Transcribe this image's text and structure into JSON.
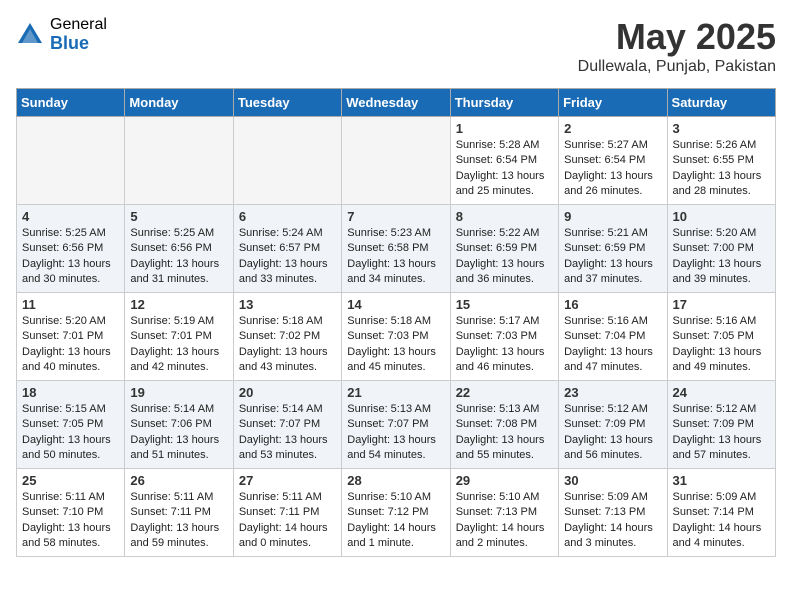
{
  "logo": {
    "general": "General",
    "blue": "Blue"
  },
  "title": {
    "month": "May 2025",
    "location": "Dullewala, Punjab, Pakistan"
  },
  "weekdays": [
    "Sunday",
    "Monday",
    "Tuesday",
    "Wednesday",
    "Thursday",
    "Friday",
    "Saturday"
  ],
  "weeks": [
    {
      "alt": false,
      "days": [
        {
          "num": "",
          "info": ""
        },
        {
          "num": "",
          "info": ""
        },
        {
          "num": "",
          "info": ""
        },
        {
          "num": "",
          "info": ""
        },
        {
          "num": "1",
          "info": "Sunrise: 5:28 AM\nSunset: 6:54 PM\nDaylight: 13 hours\nand 25 minutes."
        },
        {
          "num": "2",
          "info": "Sunrise: 5:27 AM\nSunset: 6:54 PM\nDaylight: 13 hours\nand 26 minutes."
        },
        {
          "num": "3",
          "info": "Sunrise: 5:26 AM\nSunset: 6:55 PM\nDaylight: 13 hours\nand 28 minutes."
        }
      ]
    },
    {
      "alt": true,
      "days": [
        {
          "num": "4",
          "info": "Sunrise: 5:25 AM\nSunset: 6:56 PM\nDaylight: 13 hours\nand 30 minutes."
        },
        {
          "num": "5",
          "info": "Sunrise: 5:25 AM\nSunset: 6:56 PM\nDaylight: 13 hours\nand 31 minutes."
        },
        {
          "num": "6",
          "info": "Sunrise: 5:24 AM\nSunset: 6:57 PM\nDaylight: 13 hours\nand 33 minutes."
        },
        {
          "num": "7",
          "info": "Sunrise: 5:23 AM\nSunset: 6:58 PM\nDaylight: 13 hours\nand 34 minutes."
        },
        {
          "num": "8",
          "info": "Sunrise: 5:22 AM\nSunset: 6:59 PM\nDaylight: 13 hours\nand 36 minutes."
        },
        {
          "num": "9",
          "info": "Sunrise: 5:21 AM\nSunset: 6:59 PM\nDaylight: 13 hours\nand 37 minutes."
        },
        {
          "num": "10",
          "info": "Sunrise: 5:20 AM\nSunset: 7:00 PM\nDaylight: 13 hours\nand 39 minutes."
        }
      ]
    },
    {
      "alt": false,
      "days": [
        {
          "num": "11",
          "info": "Sunrise: 5:20 AM\nSunset: 7:01 PM\nDaylight: 13 hours\nand 40 minutes."
        },
        {
          "num": "12",
          "info": "Sunrise: 5:19 AM\nSunset: 7:01 PM\nDaylight: 13 hours\nand 42 minutes."
        },
        {
          "num": "13",
          "info": "Sunrise: 5:18 AM\nSunset: 7:02 PM\nDaylight: 13 hours\nand 43 minutes."
        },
        {
          "num": "14",
          "info": "Sunrise: 5:18 AM\nSunset: 7:03 PM\nDaylight: 13 hours\nand 45 minutes."
        },
        {
          "num": "15",
          "info": "Sunrise: 5:17 AM\nSunset: 7:03 PM\nDaylight: 13 hours\nand 46 minutes."
        },
        {
          "num": "16",
          "info": "Sunrise: 5:16 AM\nSunset: 7:04 PM\nDaylight: 13 hours\nand 47 minutes."
        },
        {
          "num": "17",
          "info": "Sunrise: 5:16 AM\nSunset: 7:05 PM\nDaylight: 13 hours\nand 49 minutes."
        }
      ]
    },
    {
      "alt": true,
      "days": [
        {
          "num": "18",
          "info": "Sunrise: 5:15 AM\nSunset: 7:05 PM\nDaylight: 13 hours\nand 50 minutes."
        },
        {
          "num": "19",
          "info": "Sunrise: 5:14 AM\nSunset: 7:06 PM\nDaylight: 13 hours\nand 51 minutes."
        },
        {
          "num": "20",
          "info": "Sunrise: 5:14 AM\nSunset: 7:07 PM\nDaylight: 13 hours\nand 53 minutes."
        },
        {
          "num": "21",
          "info": "Sunrise: 5:13 AM\nSunset: 7:07 PM\nDaylight: 13 hours\nand 54 minutes."
        },
        {
          "num": "22",
          "info": "Sunrise: 5:13 AM\nSunset: 7:08 PM\nDaylight: 13 hours\nand 55 minutes."
        },
        {
          "num": "23",
          "info": "Sunrise: 5:12 AM\nSunset: 7:09 PM\nDaylight: 13 hours\nand 56 minutes."
        },
        {
          "num": "24",
          "info": "Sunrise: 5:12 AM\nSunset: 7:09 PM\nDaylight: 13 hours\nand 57 minutes."
        }
      ]
    },
    {
      "alt": false,
      "days": [
        {
          "num": "25",
          "info": "Sunrise: 5:11 AM\nSunset: 7:10 PM\nDaylight: 13 hours\nand 58 minutes."
        },
        {
          "num": "26",
          "info": "Sunrise: 5:11 AM\nSunset: 7:11 PM\nDaylight: 13 hours\nand 59 minutes."
        },
        {
          "num": "27",
          "info": "Sunrise: 5:11 AM\nSunset: 7:11 PM\nDaylight: 14 hours\nand 0 minutes."
        },
        {
          "num": "28",
          "info": "Sunrise: 5:10 AM\nSunset: 7:12 PM\nDaylight: 14 hours\nand 1 minute."
        },
        {
          "num": "29",
          "info": "Sunrise: 5:10 AM\nSunset: 7:13 PM\nDaylight: 14 hours\nand 2 minutes."
        },
        {
          "num": "30",
          "info": "Sunrise: 5:09 AM\nSunset: 7:13 PM\nDaylight: 14 hours\nand 3 minutes."
        },
        {
          "num": "31",
          "info": "Sunrise: 5:09 AM\nSunset: 7:14 PM\nDaylight: 14 hours\nand 4 minutes."
        }
      ]
    }
  ]
}
